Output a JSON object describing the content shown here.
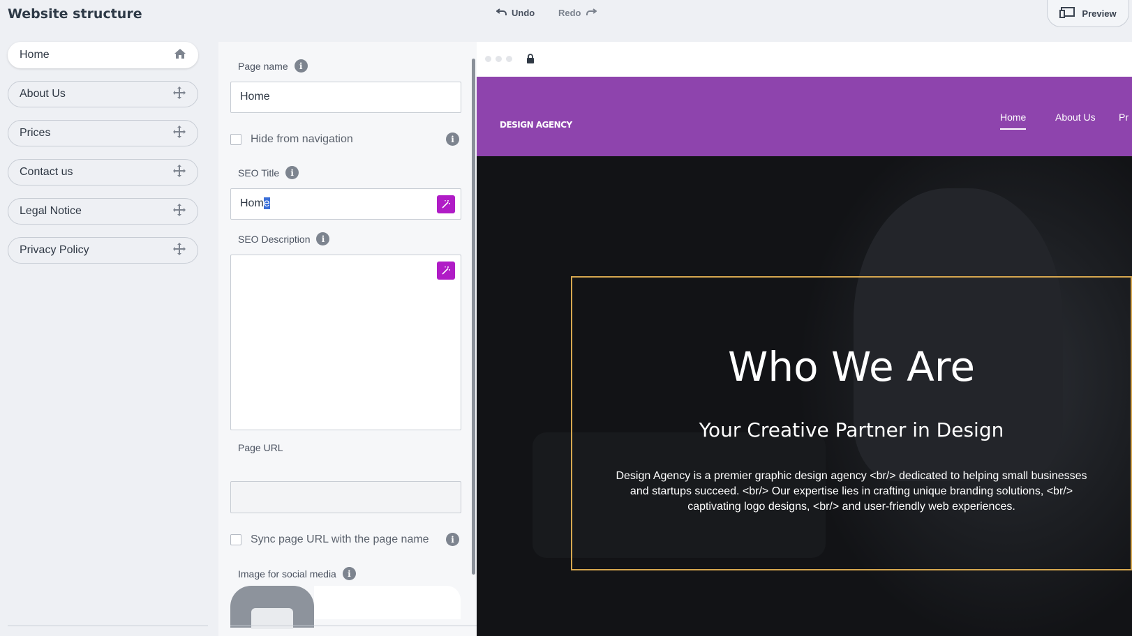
{
  "header": {
    "title": "Website structure",
    "undo_label": "Undo",
    "redo_label": "Redo",
    "preview_label": "Preview"
  },
  "sidebar": {
    "items": [
      {
        "label": "Home",
        "icon": "home-icon",
        "active": true
      },
      {
        "label": "About Us",
        "icon": "move-icon"
      },
      {
        "label": "Prices",
        "icon": "move-icon"
      },
      {
        "label": "Contact us",
        "icon": "move-icon"
      },
      {
        "label": "Legal Notice",
        "icon": "move-icon"
      },
      {
        "label": "Privacy Policy",
        "icon": "move-icon"
      }
    ]
  },
  "form": {
    "page_name_label": "Page name",
    "page_name_value": "Home",
    "hide_nav_label": "Hide from navigation",
    "seo_title_label": "SEO Title",
    "seo_title_value_plain": "Hom",
    "seo_title_value_selected": "e",
    "seo_description_label": "SEO Description",
    "seo_description_value": "",
    "page_url_label": "Page URL",
    "page_url_value": "",
    "sync_url_label": "Sync page URL with the page name",
    "social_image_label": "Image for social media"
  },
  "preview": {
    "logo": "DESIGN AGENCY",
    "nav": [
      "Home",
      "About Us",
      "Pr"
    ],
    "hero_title": "Who We Are",
    "hero_subtitle": "Your Creative Partner in Design",
    "hero_body": "Design Agency is a premier graphic design agency <br/> dedicated to helping small businesses and startups succeed. <br/> Our expertise lies in crafting unique branding solutions, <br/> captivating logo designs, <br/> and user-friendly web experiences."
  },
  "colors": {
    "accent": "#b01cc6",
    "site_header": "#8e44ad",
    "hero_frame": "#d6a74f"
  }
}
